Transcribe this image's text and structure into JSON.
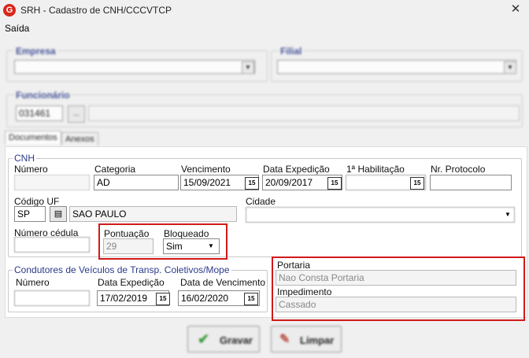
{
  "window": {
    "title": "SRH - Cadastro de CNH/CCCVTCP",
    "close_glyph": "✕"
  },
  "menu": {
    "items": [
      "Saída"
    ]
  },
  "empresa": {
    "label": "Empresa",
    "value": ""
  },
  "filial": {
    "label": "Filial",
    "value": ""
  },
  "funcionario": {
    "label": "Funcionário",
    "code": "031461",
    "name": ""
  },
  "tabs": [
    "Documentos",
    "Anexos"
  ],
  "cnh": {
    "title": "CNH",
    "numero": {
      "label": "Número",
      "value": ""
    },
    "categoria": {
      "label": "Categoria",
      "value": "AD"
    },
    "vencimento": {
      "label": "Vencimento",
      "value": "15/09/2021"
    },
    "data_expedicao": {
      "label": "Data Expedição",
      "value": "20/09/2017"
    },
    "primeira_habilitacao": {
      "label": "1ª Habilitação",
      "value": ""
    },
    "nr_protocolo": {
      "label": "Nr. Protocolo",
      "value": ""
    },
    "codigo_uf": {
      "label": "Código UF",
      "code": "SP",
      "name": "SAO PAULO"
    },
    "cidade": {
      "label": "Cidade",
      "value": ""
    },
    "numero_cedula": {
      "label": "Número cédula",
      "value": ""
    },
    "pontuacao": {
      "label": "Pontuação",
      "value": "29"
    },
    "bloqueado": {
      "label": "Bloqueado",
      "value": "Sim"
    }
  },
  "condutores": {
    "title": "Condutores de Veículos de Transp. Coletivos/Mope",
    "numero": {
      "label": "Número",
      "value": ""
    },
    "data_expedicao": {
      "label": "Data Expedição",
      "value": "17/02/2019"
    },
    "data_vencimento": {
      "label": "Data de Vencimento",
      "value": "16/02/2020"
    }
  },
  "portaria": {
    "label": "Portaria",
    "value": "Nao Consta Portaria"
  },
  "impedimento": {
    "label": "Impedimento",
    "value": "Cassado"
  },
  "buttons": {
    "gravar": "Gravar",
    "limpar": "Limpar"
  },
  "icons": {
    "calendar": "15",
    "combo": "▼",
    "lookup": "..."
  },
  "colors": {
    "highlight": "#d11a1a",
    "group_title": "#2b3a8a"
  }
}
